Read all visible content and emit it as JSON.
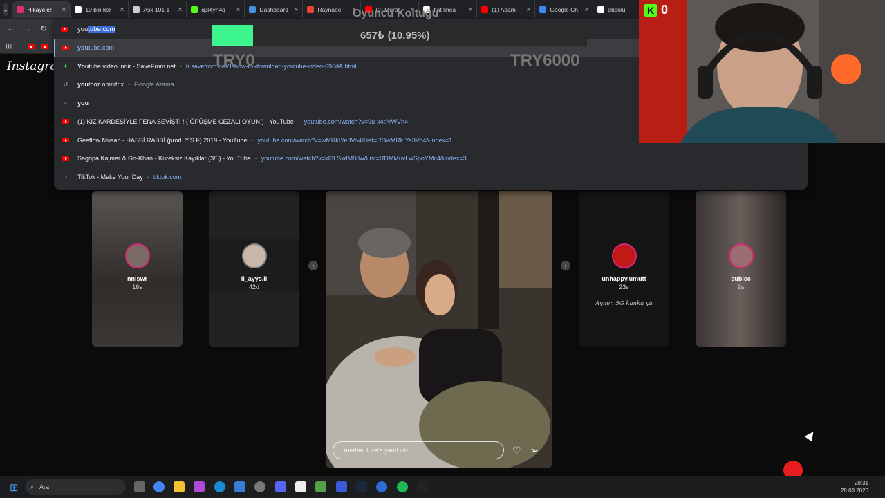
{
  "tabs": [
    {
      "title": "Hikayeler",
      "color": "#e1306c",
      "active": true
    },
    {
      "title": "10 bin ker",
      "color": "#ffffff"
    },
    {
      "title": "Aşk 101 1",
      "color": "#cccccc"
    },
    {
      "title": "q3l4yn4q",
      "color": "#53fc18"
    },
    {
      "title": "Dashboard",
      "color": "#4a90e2"
    },
    {
      "title": "Raynaee",
      "color": "#ea4335"
    },
    {
      "title": "(2) Murat",
      "color": "#ff0000"
    },
    {
      "title": "fiat linea",
      "color": "#ffffff"
    },
    {
      "title": "(1) Adam",
      "color": "#ff0000"
    },
    {
      "title": "Google Ch",
      "color": "#4285f4"
    },
    {
      "title": "absolu",
      "color": "#ffffff"
    }
  ],
  "omnibox": {
    "typed": "you",
    "autocomplete": "tube.com",
    "suggestions": [
      {
        "bold": "you",
        "rest": "tube.com",
        "url": "",
        "icon": "youtube-icon",
        "kind": "url"
      },
      {
        "bold": "You",
        "rest": "tube video indir - SaveFrom.net",
        "url": "tr.savefrom.net/1-how-to-download-youtube-video-696dA.html",
        "icon": "download-icon",
        "kind": "page"
      },
      {
        "bold": "you",
        "rest": " tooz omnitrix",
        "url": "Google Arama",
        "icon": "history-icon",
        "kind": "search"
      },
      {
        "bold": "you",
        "rest": "",
        "url": "",
        "icon": "search-icon",
        "kind": "search"
      },
      {
        "bold": "",
        "rest": "(1) KIZ KARDEŞİYLE FENA SEVİŞTİ ! ( ÖPÜŞME CEZALI OYUN ) - YouTube",
        "url": "youtube.com/watch?v=9u-x4pVWVn4",
        "icon": "youtube-icon",
        "kind": "page"
      },
      {
        "bold": "",
        "rest": "Geeflow Musab - HASBİ RABBİ (prod. Y.S.F) 2019 - YouTube",
        "url": "youtube.com/watch?v=wMRkIYe3Vo4&list=RDwMRkIYe3Vo4&index=1",
        "icon": "youtube-icon",
        "kind": "page"
      },
      {
        "bold": "",
        "rest": "Sagopa Kajmer & Go-Khan - Küreksiz Kayıklar (3/5) - YouTube",
        "url": "youtube.com/watch?v=kI3LSxdM80w&list=RDMMuvLwSpoYMc4&index=3",
        "icon": "youtube-icon",
        "kind": "page"
      },
      {
        "bold": "",
        "rest": "TikTok - Make Your Day",
        "url": "tiktok.com",
        "icon": "tiktok-icon",
        "kind": "page"
      }
    ]
  },
  "instagram": {
    "logo": "Instagram",
    "stories": [
      {
        "user": "nniswr",
        "time": "16s"
      },
      {
        "user": "ll_ayys.ll",
        "time": "42d"
      },
      {
        "user": "unhappy.umutt",
        "time": "23s",
        "caption": "Aynen 5G kanka ya"
      },
      {
        "user": "sublcc",
        "time": "9s"
      }
    ],
    "reply_placeholder": "suedaauluca'e yanıt ver..."
  },
  "overlay": {
    "title": "Oyuncu Koltuğu",
    "value_text": "657₺ (10.95%)",
    "progress": 0.1095,
    "min": "TRY0",
    "max": "TRY6000",
    "accent": "#3cf58c"
  },
  "kick": {
    "count": "0",
    "color": "#53fc18"
  },
  "taskbar": {
    "search_placeholder": "Ara",
    "time": "20:31",
    "date": "28.03.2026"
  }
}
